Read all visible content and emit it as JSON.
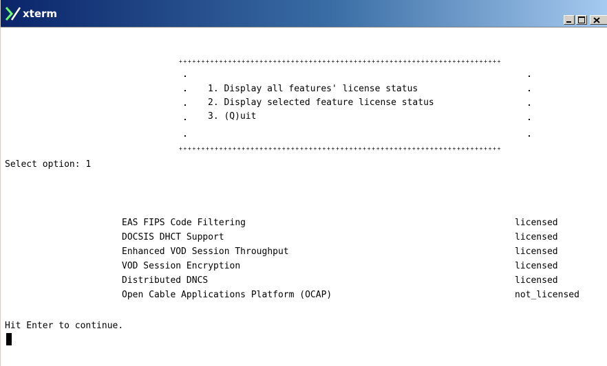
{
  "window": {
    "title": "xterm",
    "app_icon": "x-logo-icon",
    "controls": [
      "minimize-icon",
      "maximize-icon",
      "close-icon"
    ]
  },
  "menu": {
    "border_line": "++++++++++++++++++++++++++++++++++++++++++++++++++++++++++++++++++++++++",
    "items": [
      "1. Display all features' license status",
      "2. Display selected feature license status",
      "3. (Q)uit"
    ]
  },
  "prompt": {
    "label": "Select option: 1"
  },
  "features": [
    {
      "name": "EAS FIPS Code Filtering",
      "status": "licensed"
    },
    {
      "name": "DOCSIS DHCT Support",
      "status": "licensed"
    },
    {
      "name": "Enhanced VOD Session Throughput",
      "status": "licensed"
    },
    {
      "name": "VOD Session Encryption",
      "status": "licensed"
    },
    {
      "name": "Distributed DNCS",
      "status": "licensed"
    },
    {
      "name": "Open Cable Applications Platform (OCAP)",
      "status": "not_licensed"
    }
  ],
  "footer": {
    "continue_text": "Hit Enter to continue."
  }
}
